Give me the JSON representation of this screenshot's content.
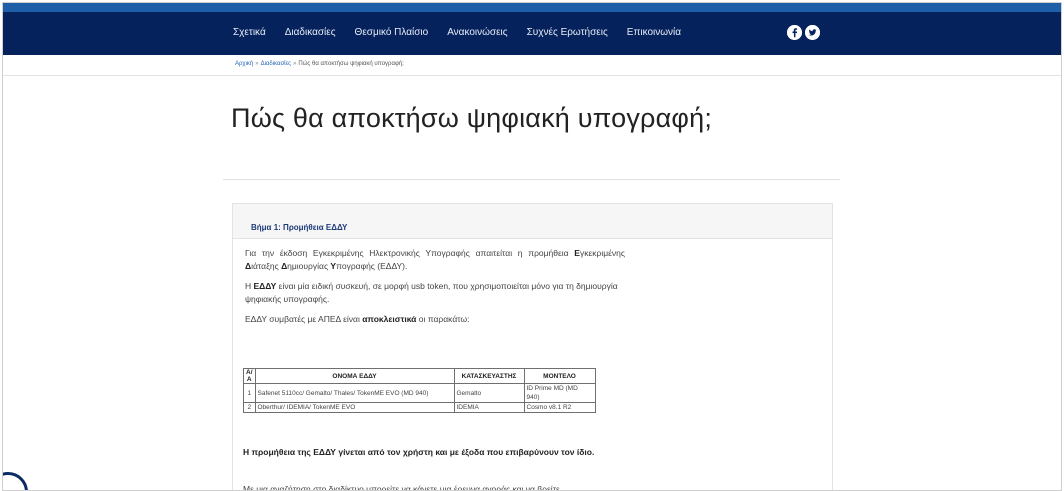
{
  "nav": {
    "items": [
      {
        "label": "Σχετικά"
      },
      {
        "label": "Διαδικασίες"
      },
      {
        "label": "Θεσμικό Πλαίσιο"
      },
      {
        "label": "Ανακοινώσεις"
      },
      {
        "label": "Συχνές Ερωτήσεις"
      },
      {
        "label": "Επικοινωνία"
      }
    ],
    "social": [
      "facebook-icon",
      "twitter-icon"
    ]
  },
  "breadcrumb": {
    "home": "Αρχική",
    "section": "Διαδικασίες",
    "current": "Πώς θα αποκτήσω ψηφιακή υπογραφή;"
  },
  "page": {
    "title": "Πώς θα αποκτήσω ψηφιακή υπογραφή;"
  },
  "step": {
    "heading": "Βήμα 1: Προμήθεια ΕΔΔΥ",
    "p1_a": "Για την έκδοση Εγκεκριμένης Ηλεκτρονικής Υπογραφής απαιτείται η προμήθεια ",
    "p1_b1": "Ε",
    "p1_c": "γκεκριμένης ",
    "p1_b2": "Δ",
    "p1_d": "ιάταξης ",
    "p1_b3": "Δ",
    "p1_e": "ημιουργίας ",
    "p1_b4": "Υ",
    "p1_f": "πογραφής (ΕΔΔΥ).",
    "p2_a": "Η ",
    "p2_b": "ΕΔΔΥ",
    "p2_c": " είναι μία ειδική συσκευή, σε μορφή usb token, που χρησιμοποιείται μόνο για τη δημιουργία ψηφιακής υπογραφής.",
    "p3_a": "ΕΔΔΥ συμβατές με ΑΠΕΔ είναι ",
    "p3_b": "αποκλειστικά",
    "p3_c": " οι παρακάτω:",
    "bold_note": "Η προμήθεια της ΕΔΔΥ γίνεται από τον χρήστη και με έξοδα που επιβαρύνουν τον ίδιο.",
    "last_line": "Με μια αναζήτηση στο διαδίκτυο μπορείτε να κάνετε μια έρευνα αγοράς και να βρείτε"
  },
  "table": {
    "headers": [
      "Α/Α",
      "ΟΝΟΜΑ ΕΔΔΥ",
      "ΚΑΤΑΣΚΕΥΑΣΤΗΣ",
      "ΜΟΝΤΕΛΟ"
    ],
    "rows": [
      [
        "1",
        "Safenet 5110cc/ Gemalto/ Thales/ TokenME EVO (MD 940)",
        "Gemalto",
        "ID Prime MD (MD 940)"
      ],
      [
        "2",
        "Oberthur/ IDEMIA/ TokenME EVO",
        "IDEMIA",
        "Cosmo v8.1 R2"
      ]
    ]
  }
}
